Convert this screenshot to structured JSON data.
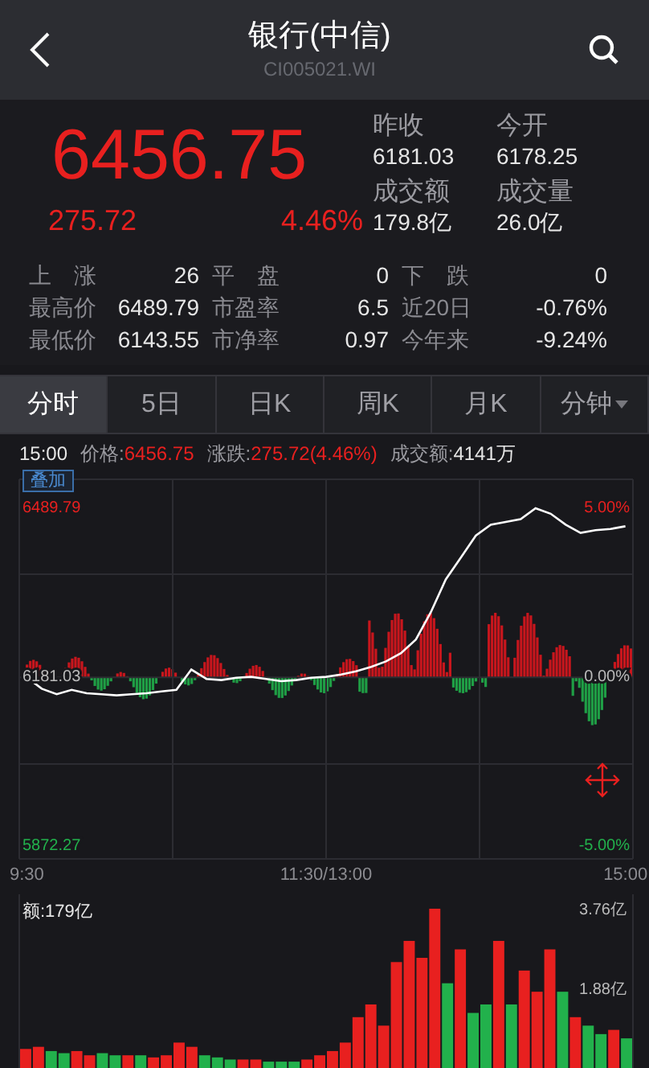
{
  "header": {
    "title": "银行(中信)",
    "code": "CI005021.WI"
  },
  "quote": {
    "price": "6456.75",
    "change": "275.72",
    "change_pct": "4.46%",
    "fields": [
      {
        "label": "昨收",
        "value": "6181.03"
      },
      {
        "label": "今开",
        "value": "6178.25"
      },
      {
        "label": "成交额",
        "value": "179.8亿"
      },
      {
        "label": "成交量",
        "value": "26.0亿"
      }
    ]
  },
  "stats": [
    {
      "label": "上　涨",
      "value": "26"
    },
    {
      "label": "平　盘",
      "value": "0"
    },
    {
      "label": "下　跌",
      "value": "0"
    },
    {
      "label": "最高价",
      "value": "6489.79"
    },
    {
      "label": "市盈率",
      "value": "6.5"
    },
    {
      "label": "近20日",
      "value": "-0.76%"
    },
    {
      "label": "最低价",
      "value": "6143.55"
    },
    {
      "label": "市净率",
      "value": "0.97"
    },
    {
      "label": "今年来",
      "value": "-9.24%"
    }
  ],
  "tabs": [
    {
      "label": "分时",
      "selected": true,
      "kind": "plain"
    },
    {
      "label": "5日",
      "selected": false,
      "kind": "plain"
    },
    {
      "label": "日K",
      "selected": false,
      "kind": "plain"
    },
    {
      "label": "周K",
      "selected": false,
      "kind": "plain"
    },
    {
      "label": "月K",
      "selected": false,
      "kind": "plain"
    },
    {
      "label": "分钟",
      "selected": false,
      "kind": "dropdown"
    }
  ],
  "info": {
    "time": "15:00",
    "items": [
      {
        "label": "价格:",
        "value": "6456.75",
        "color": "#e8201f"
      },
      {
        "label": "涨跌:",
        "value": "275.72(4.46%)",
        "color": "#e8201f"
      },
      {
        "label": "成交额:",
        "value": "4141万",
        "color": "#e6e6e6"
      }
    ]
  },
  "overlay_button": "叠加",
  "price_chart": {
    "percent_labels": [
      "5.00%",
      "0.00%",
      "-5.00%"
    ],
    "chart_data": {
      "type": "line",
      "categories": [
        "9:30",
        null,
        null,
        null,
        null,
        null,
        null,
        null,
        null,
        null,
        null,
        null,
        null,
        null,
        null,
        null,
        null,
        null,
        null,
        null,
        "11:30/13:00",
        null,
        null,
        null,
        null,
        null,
        null,
        null,
        null,
        null,
        null,
        null,
        null,
        null,
        null,
        null,
        null,
        null,
        null,
        null,
        "15:00"
      ],
      "series": [
        {
          "color": "#ffffff",
          "values": [
            6181,
            6160,
            6150,
            6158,
            6152,
            6150,
            6148,
            6150,
            6152,
            6155,
            6158,
            6195,
            6178,
            6176,
            6180,
            6182,
            6178,
            6174,
            6176,
            6180,
            6182,
            6186,
            6192,
            6200,
            6210,
            6225,
            6250,
            6300,
            6360,
            6400,
            6440,
            6460,
            6465,
            6470,
            6490,
            6480,
            6460,
            6445,
            6450,
            6452,
            6457
          ]
        }
      ],
      "ylim": [
        5849,
        6543
      ],
      "yticks": [
        {
          "value": 5872.27,
          "label": "5872.27"
        },
        {
          "value": 6181.03,
          "label": "6181.03"
        },
        {
          "value": 6489.79,
          "label": "6489.79"
        }
      ]
    }
  },
  "volume_chart": {
    "label": "额:179亿",
    "chart_data": {
      "type": "bar",
      "series": [
        {
          "color": "#e8201f",
          "values": [
            0.45,
            0.5,
            null,
            null,
            0.4,
            0.3,
            null,
            null,
            0.3,
            null,
            0.25,
            0.3,
            0.6,
            0.5,
            null,
            null,
            null,
            0.2,
            0.2,
            null,
            null,
            null,
            0.2,
            0.3,
            0.4,
            0.6,
            1.2,
            1.5,
            1.0,
            2.5,
            3.0,
            2.6,
            3.76,
            null,
            2.8,
            null,
            null,
            3.0,
            null,
            2.3,
            1.8,
            2.8,
            null,
            1.2,
            null,
            null,
            0.9,
            null
          ]
        },
        {
          "color": "#22b14c",
          "values": [
            null,
            null,
            0.4,
            0.35,
            null,
            null,
            0.35,
            0.3,
            null,
            0.3,
            null,
            null,
            null,
            null,
            0.3,
            0.25,
            0.2,
            null,
            null,
            0.15,
            0.15,
            0.15,
            null,
            null,
            null,
            null,
            null,
            null,
            null,
            null,
            null,
            null,
            null,
            2.0,
            null,
            1.3,
            1.5,
            null,
            1.5,
            null,
            null,
            null,
            1.8,
            null,
            1.0,
            0.8,
            null,
            0.7
          ]
        }
      ],
      "stacked": true,
      "ylim": [
        0,
        4.1
      ],
      "yticks": [
        {
          "value": 1.88,
          "label": "1.88亿"
        },
        {
          "value": 3.76,
          "label": "3.76亿"
        }
      ]
    }
  }
}
